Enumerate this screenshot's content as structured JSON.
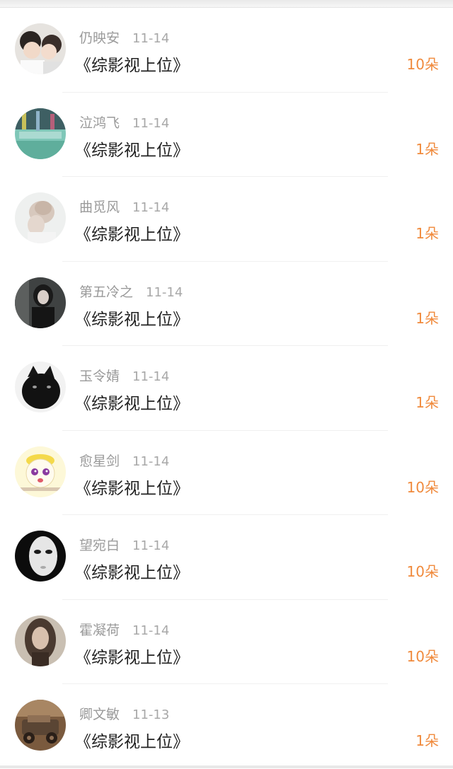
{
  "gifts": [
    {
      "name": "仍映安",
      "date": "11-14",
      "title": "《综影视上位》",
      "count": "10朵",
      "avatar": "couple-photo"
    },
    {
      "name": "泣鸿飞",
      "date": "11-14",
      "title": "《综影视上位》",
      "count": "1朵",
      "avatar": "however-text-photo"
    },
    {
      "name": "曲觅风",
      "date": "11-14",
      "title": "《综影视上位》",
      "count": "1朵",
      "avatar": "girl-back-photo"
    },
    {
      "name": "第五冷之",
      "date": "11-14",
      "title": "《综影视上位》",
      "count": "1朵",
      "avatar": "girl-dark-photo"
    },
    {
      "name": "玉令婧",
      "date": "11-14",
      "title": "《综影视上位》",
      "count": "1朵",
      "avatar": "black-cat-photo"
    },
    {
      "name": "愈星剑",
      "date": "11-14",
      "title": "《综影视上位》",
      "count": "10朵",
      "avatar": "cartoon-face"
    },
    {
      "name": "望宛白",
      "date": "11-14",
      "title": "《综影视上位》",
      "count": "10朵",
      "avatar": "white-mask-photo"
    },
    {
      "name": "霍凝荷",
      "date": "11-14",
      "title": "《综影视上位》",
      "count": "10朵",
      "avatar": "woman-portrait-photo"
    },
    {
      "name": "卿文敏",
      "date": "11-13",
      "title": "《综影视上位》",
      "count": "1朵",
      "avatar": "old-car-photo"
    }
  ],
  "colors": {
    "gift_count": "#f08a3c",
    "name": "#9a9a9a",
    "title": "#222222"
  }
}
